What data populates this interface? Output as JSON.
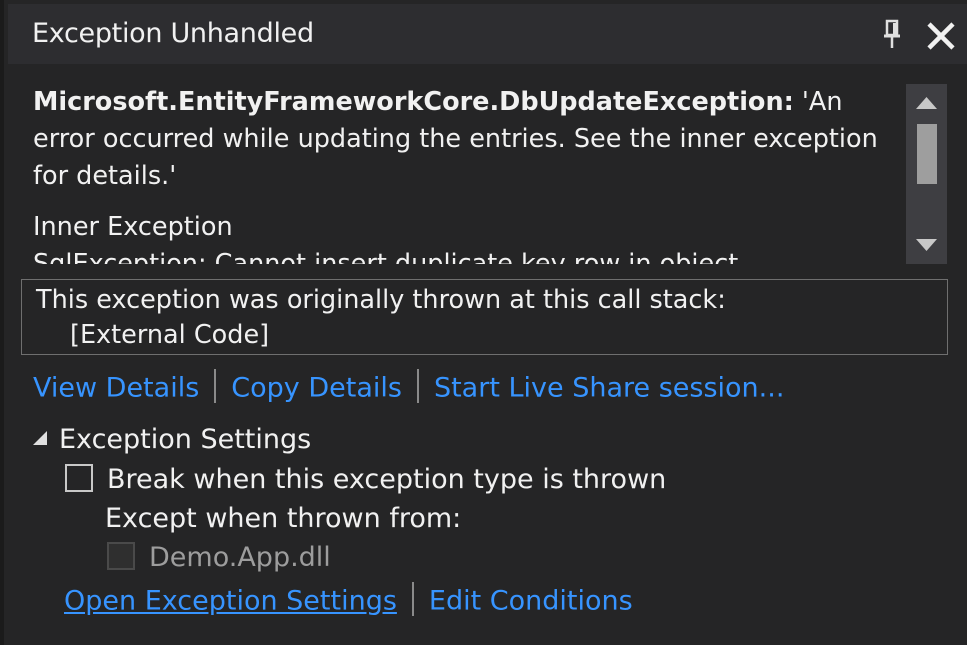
{
  "window": {
    "title": "Exception Unhandled",
    "pin_icon": "pin-icon",
    "close_icon": "close-icon"
  },
  "message": {
    "exception_type": "Microsoft.EntityFrameworkCore.DbUpdateException:",
    "exception_text": " 'An error occurred while updating the entries. See the inner exception for details.'",
    "inner_label": "Inner Exception",
    "inner_text": "SqlException: Cannot insert duplicate key row in object"
  },
  "call_stack": {
    "header": "This exception was originally thrown at this call stack:",
    "frames": [
      "[External Code]"
    ]
  },
  "actions": {
    "view_details": "View Details",
    "copy_details": "Copy Details",
    "live_share": "Start Live Share session..."
  },
  "settings": {
    "header": "Exception Settings",
    "break_label": "Break when this exception type is thrown",
    "break_checked": false,
    "except_label": "Except when thrown from:",
    "module_label": "Demo.App.dll",
    "module_checked": false,
    "open_settings": "Open Exception Settings",
    "edit_conditions": "Edit Conditions"
  },
  "colors": {
    "background": "#252526",
    "titlebar": "#2d2d30",
    "link": "#3794ff",
    "text": "#f1f1f1",
    "disabled_text": "#9d9d9d"
  }
}
